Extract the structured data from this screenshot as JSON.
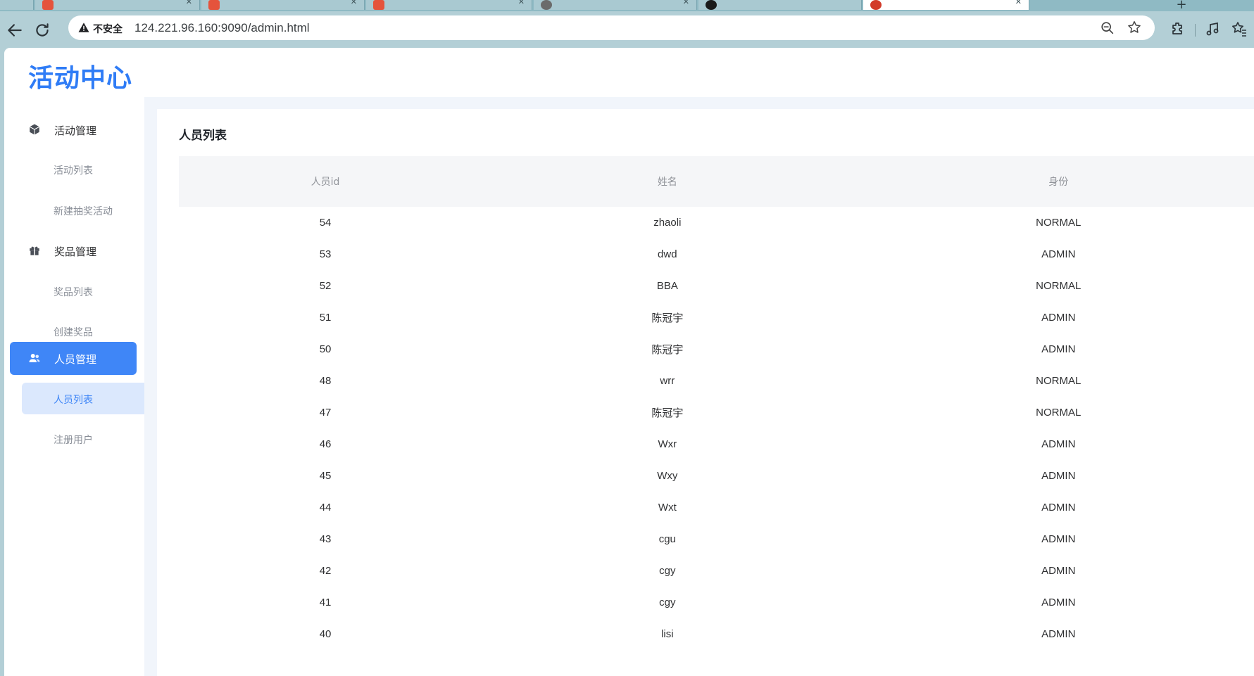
{
  "browser": {
    "address_warning": "不安全",
    "url": "124.221.96.160:9090/admin.html",
    "new_tab_label": "+"
  },
  "app": {
    "logo": "活动中心"
  },
  "sidebar": {
    "groups": [
      {
        "label": "活动管理",
        "icon": "box-icon",
        "items": [
          {
            "label": "活动列表"
          },
          {
            "label": "新建抽奖活动"
          }
        ]
      },
      {
        "label": "奖品管理",
        "icon": "gift-icon",
        "items": [
          {
            "label": "奖品列表"
          },
          {
            "label": "创建奖品"
          }
        ]
      },
      {
        "label": "人员管理",
        "icon": "users-icon",
        "active": true,
        "items": [
          {
            "label": "人员列表",
            "active": true
          },
          {
            "label": "注册用户"
          }
        ]
      }
    ]
  },
  "main": {
    "title": "人员列表",
    "columns": [
      "人员id",
      "姓名",
      "身份"
    ],
    "rows": [
      {
        "id": "54",
        "name": "zhaoli",
        "role": "NORMAL"
      },
      {
        "id": "53",
        "name": "dwd",
        "role": "ADMIN"
      },
      {
        "id": "52",
        "name": "BBA",
        "role": "NORMAL"
      },
      {
        "id": "51",
        "name": "陈冠宇",
        "role": "ADMIN"
      },
      {
        "id": "50",
        "name": "陈冠宇",
        "role": "ADMIN"
      },
      {
        "id": "48",
        "name": "wrr",
        "role": "NORMAL"
      },
      {
        "id": "47",
        "name": "陈冠宇",
        "role": "NORMAL"
      },
      {
        "id": "46",
        "name": "Wxr",
        "role": "ADMIN"
      },
      {
        "id": "45",
        "name": "Wxy",
        "role": "ADMIN"
      },
      {
        "id": "44",
        "name": "Wxt",
        "role": "ADMIN"
      },
      {
        "id": "43",
        "name": "cgu",
        "role": "ADMIN"
      },
      {
        "id": "42",
        "name": "cgy",
        "role": "ADMIN"
      },
      {
        "id": "41",
        "name": "cgy",
        "role": "ADMIN"
      },
      {
        "id": "40",
        "name": "lisi",
        "role": "ADMIN"
      }
    ]
  },
  "colors": {
    "accent": "#3f86f7",
    "logo": "#2f7cf6",
    "submenu_active_bg": "#dbe8fd"
  }
}
